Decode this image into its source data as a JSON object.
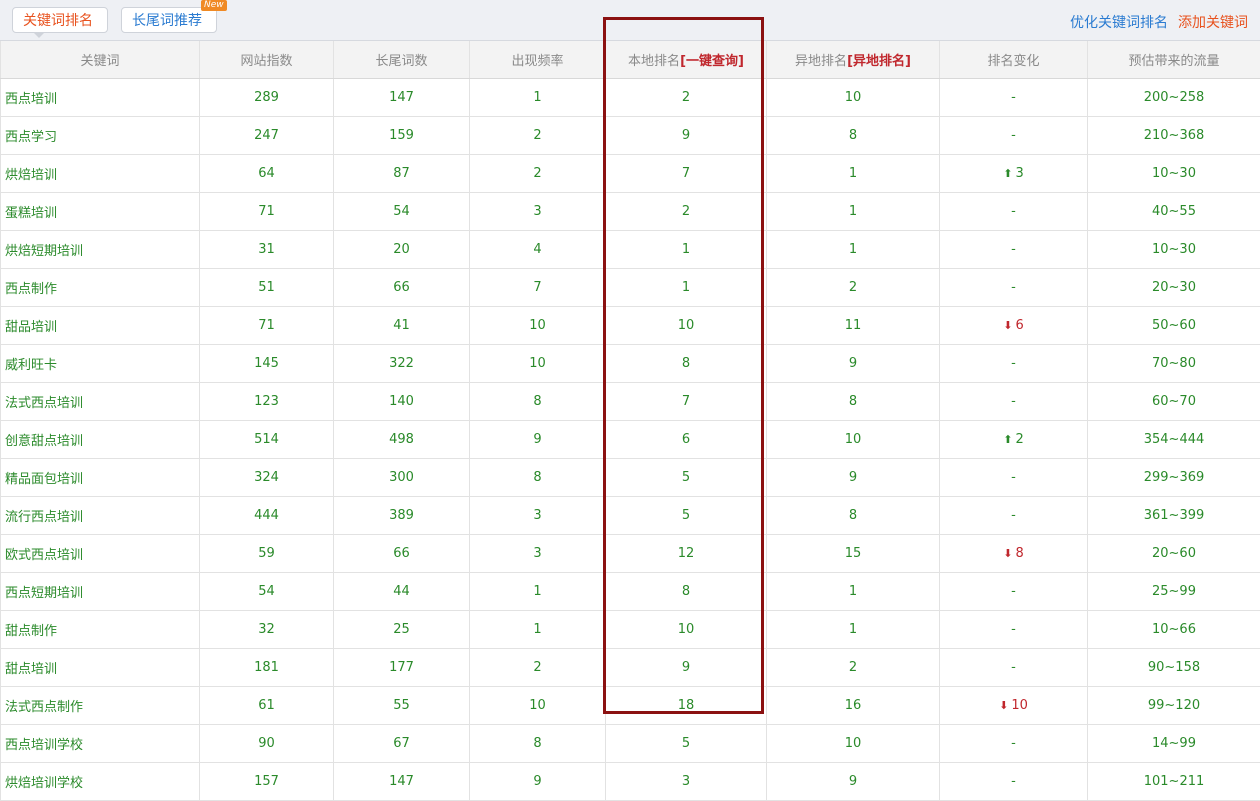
{
  "tabs": [
    {
      "label": "关键词排名"
    },
    {
      "label": "长尾词推荐",
      "badge": "New"
    }
  ],
  "links": {
    "optimize": "优化关键词排名",
    "add": "添加关键词"
  },
  "columns": {
    "keyword": "关键词",
    "site_index": "网站指数",
    "long_tail": "长尾词数",
    "frequency": "出现频率",
    "local_rank": "本地排名",
    "local_query": "[一键查询]",
    "remote_rank": "异地排名",
    "remote_link": "[异地排名]",
    "change": "排名变化",
    "traffic": "预估带来的流量"
  },
  "colors": {
    "up": "#2a8a2a",
    "down": "#c0272d",
    "highlight_border": "#8b1111",
    "accent_orange": "#e8521e",
    "link_blue": "#2a7bd1"
  },
  "rows": [
    {
      "keyword": "西点培训",
      "index": "289",
      "long_tail": "147",
      "freq": "1",
      "local": "2",
      "remote": "10",
      "change": "-",
      "dir": "none",
      "traffic": "200~258"
    },
    {
      "keyword": "西点学习",
      "index": "247",
      "long_tail": "159",
      "freq": "2",
      "local": "9",
      "remote": "8",
      "change": "-",
      "dir": "none",
      "traffic": "210~368"
    },
    {
      "keyword": "烘焙培训",
      "index": "64",
      "long_tail": "87",
      "freq": "2",
      "local": "7",
      "remote": "1",
      "change": "3",
      "dir": "up",
      "traffic": "10~30"
    },
    {
      "keyword": "蛋糕培训",
      "index": "71",
      "long_tail": "54",
      "freq": "3",
      "local": "2",
      "remote": "1",
      "change": "-",
      "dir": "none",
      "traffic": "40~55"
    },
    {
      "keyword": "烘焙短期培训",
      "index": "31",
      "long_tail": "20",
      "freq": "4",
      "local": "1",
      "remote": "1",
      "change": "-",
      "dir": "none",
      "traffic": "10~30"
    },
    {
      "keyword": "西点制作",
      "index": "51",
      "long_tail": "66",
      "freq": "7",
      "local": "1",
      "remote": "2",
      "change": "-",
      "dir": "none",
      "traffic": "20~30"
    },
    {
      "keyword": "甜品培训",
      "index": "71",
      "long_tail": "41",
      "freq": "10",
      "local": "10",
      "remote": "11",
      "change": "6",
      "dir": "down",
      "traffic": "50~60"
    },
    {
      "keyword": "威利旺卡",
      "index": "145",
      "long_tail": "322",
      "freq": "10",
      "local": "8",
      "remote": "9",
      "change": "-",
      "dir": "none",
      "traffic": "70~80"
    },
    {
      "keyword": "法式西点培训",
      "index": "123",
      "long_tail": "140",
      "freq": "8",
      "local": "7",
      "remote": "8",
      "change": "-",
      "dir": "none",
      "traffic": "60~70"
    },
    {
      "keyword": "创意甜点培训",
      "index": "514",
      "long_tail": "498",
      "freq": "9",
      "local": "6",
      "remote": "10",
      "change": "2",
      "dir": "up",
      "traffic": "354~444"
    },
    {
      "keyword": "精品面包培训",
      "index": "324",
      "long_tail": "300",
      "freq": "8",
      "local": "5",
      "remote": "9",
      "change": "-",
      "dir": "none",
      "traffic": "299~369"
    },
    {
      "keyword": "流行西点培训",
      "index": "444",
      "long_tail": "389",
      "freq": "3",
      "local": "5",
      "remote": "8",
      "change": "-",
      "dir": "none",
      "traffic": "361~399"
    },
    {
      "keyword": "欧式西点培训",
      "index": "59",
      "long_tail": "66",
      "freq": "3",
      "local": "12",
      "remote": "15",
      "change": "8",
      "dir": "down",
      "traffic": "20~60"
    },
    {
      "keyword": "西点短期培训",
      "index": "54",
      "long_tail": "44",
      "freq": "1",
      "local": "8",
      "remote": "1",
      "change": "-",
      "dir": "none",
      "traffic": "25~99"
    },
    {
      "keyword": "甜点制作",
      "index": "32",
      "long_tail": "25",
      "freq": "1",
      "local": "10",
      "remote": "1",
      "change": "-",
      "dir": "none",
      "traffic": "10~66"
    },
    {
      "keyword": "甜点培训",
      "index": "181",
      "long_tail": "177",
      "freq": "2",
      "local": "9",
      "remote": "2",
      "change": "-",
      "dir": "none",
      "traffic": "90~158"
    },
    {
      "keyword": "法式西点制作",
      "index": "61",
      "long_tail": "55",
      "freq": "10",
      "local": "18",
      "remote": "16",
      "change": "10",
      "dir": "down",
      "traffic": "99~120"
    },
    {
      "keyword": "西点培训学校",
      "index": "90",
      "long_tail": "67",
      "freq": "8",
      "local": "5",
      "remote": "10",
      "change": "-",
      "dir": "none",
      "traffic": "14~99"
    },
    {
      "keyword": "烘焙培训学校",
      "index": "157",
      "long_tail": "147",
      "freq": "9",
      "local": "3",
      "remote": "9",
      "change": "-",
      "dir": "none",
      "traffic": "101~211"
    }
  ]
}
